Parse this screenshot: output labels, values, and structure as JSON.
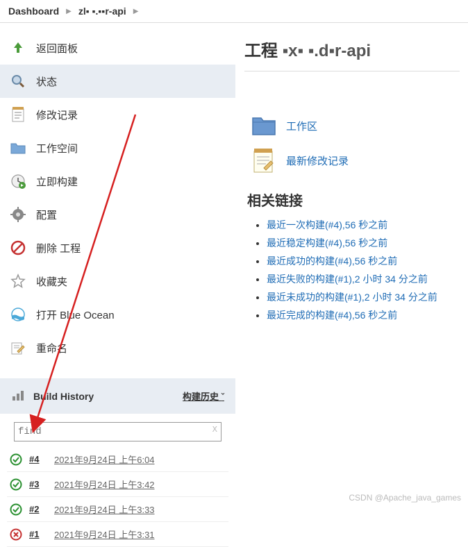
{
  "breadcrumb": {
    "dashboard": "Dashboard",
    "project": "zl▪ ▪.▪▪r-api"
  },
  "sidebar": {
    "items": [
      {
        "label": "返回面板"
      },
      {
        "label": "状态"
      },
      {
        "label": "修改记录"
      },
      {
        "label": "工作空间"
      },
      {
        "label": "立即构建"
      },
      {
        "label": "配置"
      },
      {
        "label": "删除 工程"
      },
      {
        "label": "收藏夹"
      },
      {
        "label": "打开 Blue Ocean"
      },
      {
        "label": "重命名"
      }
    ]
  },
  "buildHistory": {
    "title": "Build History",
    "trend": "构建历史",
    "searchPlaceholder": "find",
    "builds": [
      {
        "num": "#4",
        "time": "2021年9月24日 上午6:04",
        "status": "success"
      },
      {
        "num": "#3",
        "time": "2021年9月24日 上午3:42",
        "status": "success"
      },
      {
        "num": "#2",
        "time": "2021年9月24日 上午3:33",
        "status": "success"
      },
      {
        "num": "#1",
        "time": "2021年9月24日 上午3:31",
        "status": "fail"
      }
    ]
  },
  "main": {
    "titlePrefix": "工程 ",
    "titleProject": "▪x▪ ▪.d▪r-api",
    "workspace": "工作区",
    "recentChanges": "最新修改记录",
    "relatedHeader": "相关链接",
    "related": [
      "最近一次构建(#4),56 秒之前",
      "最近稳定构建(#4),56 秒之前",
      "最近成功的构建(#4),56 秒之前",
      "最近失败的构建(#1),2 小时 34 分之前",
      "最近未成功的构建(#1),2 小时 34 分之前",
      "最近完成的构建(#4),56 秒之前"
    ]
  },
  "watermark": "CSDN @Apache_java_games"
}
